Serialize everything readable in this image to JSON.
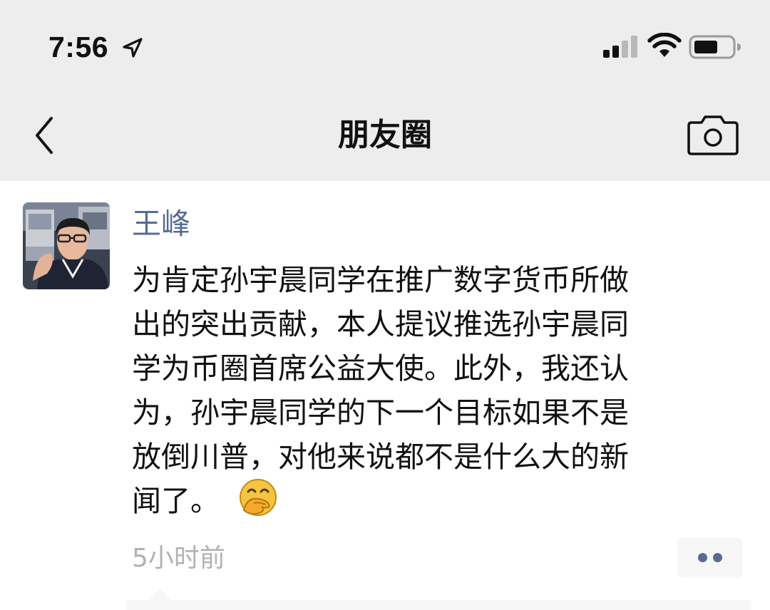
{
  "status_bar": {
    "time": "7:56",
    "location_icon": "location-arrow-icon",
    "signal_icon": "cellular-signal-icon",
    "wifi_icon": "wifi-icon",
    "battery_icon": "battery-icon"
  },
  "nav": {
    "title": "朋友圈",
    "back_icon": "chevron-left-icon",
    "camera_icon": "camera-icon"
  },
  "post": {
    "author": "王峰",
    "lines": [
      "为肯定孙宇晨同学在推广数字货币所做",
      "出的突出贡献，本人提议推选孙宇晨同",
      "学为币圈首席公益大使。此外，我还认",
      "为，孙宇晨同学的下一个目标如果不是",
      "放倒川普，对他来说都不是什么大的新",
      "闻了。"
    ],
    "emoji_icon": "face-with-hand-over-mouth-emoji",
    "timestamp": "5小时前",
    "more_icon": "more-dots-icon"
  },
  "colors": {
    "nav_background": "#ededed",
    "author_link": "#576b95",
    "timestamp_gray": "#b2b2b2",
    "text": "#111111"
  }
}
